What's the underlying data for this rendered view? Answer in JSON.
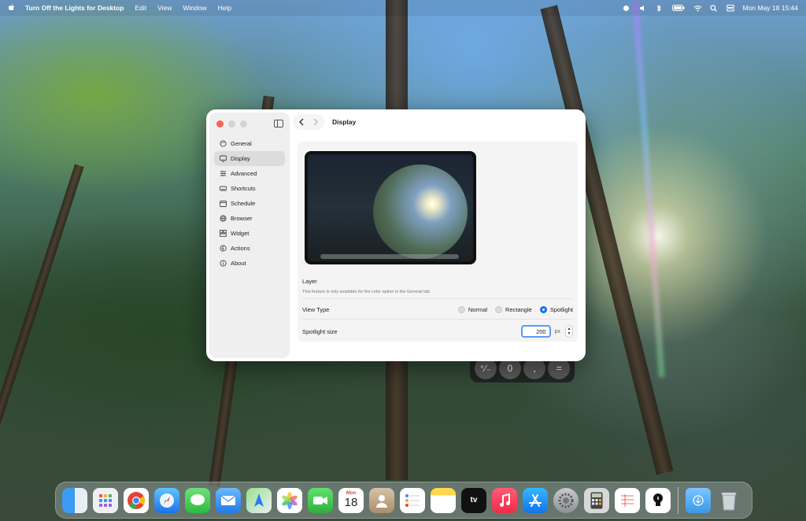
{
  "menubar": {
    "app_name": "Turn Off the Lights for Desktop",
    "menus": [
      "Edit",
      "View",
      "Window",
      "Help"
    ],
    "datetime": "Mon May 18  15:44"
  },
  "calculator_keys": [
    "⁺∕₋",
    "0",
    ",",
    "="
  ],
  "window": {
    "title": "Display",
    "sidebar": [
      {
        "label": "General",
        "icon": "palette-icon"
      },
      {
        "label": "Display",
        "icon": "display-icon",
        "active": true
      },
      {
        "label": "Advanced",
        "icon": "sliders-icon"
      },
      {
        "label": "Shortcuts",
        "icon": "keyboard-icon"
      },
      {
        "label": "Schedule",
        "icon": "calendar-icon"
      },
      {
        "label": "Browser",
        "icon": "globe-icon"
      },
      {
        "label": "Widget",
        "icon": "widget-icon"
      },
      {
        "label": "Actions",
        "icon": "bolt-icon"
      },
      {
        "label": "About",
        "icon": "info-icon"
      }
    ],
    "layer": {
      "heading": "Layer",
      "note": "This feature is only available for the color option in the General tab."
    },
    "view_type": {
      "label": "View Type",
      "options": [
        "Normal",
        "Rectangle",
        "Spotlight"
      ],
      "selected": "Spotlight"
    },
    "spotlight_size": {
      "label": "Spotlight size",
      "value": "200",
      "unit": "px"
    }
  },
  "dock": {
    "calendar_month": "Mon",
    "calendar_day": "18",
    "tv_label": "tv"
  },
  "colors": {
    "accent": "#1a6fe8",
    "close": "#fe5f57"
  }
}
